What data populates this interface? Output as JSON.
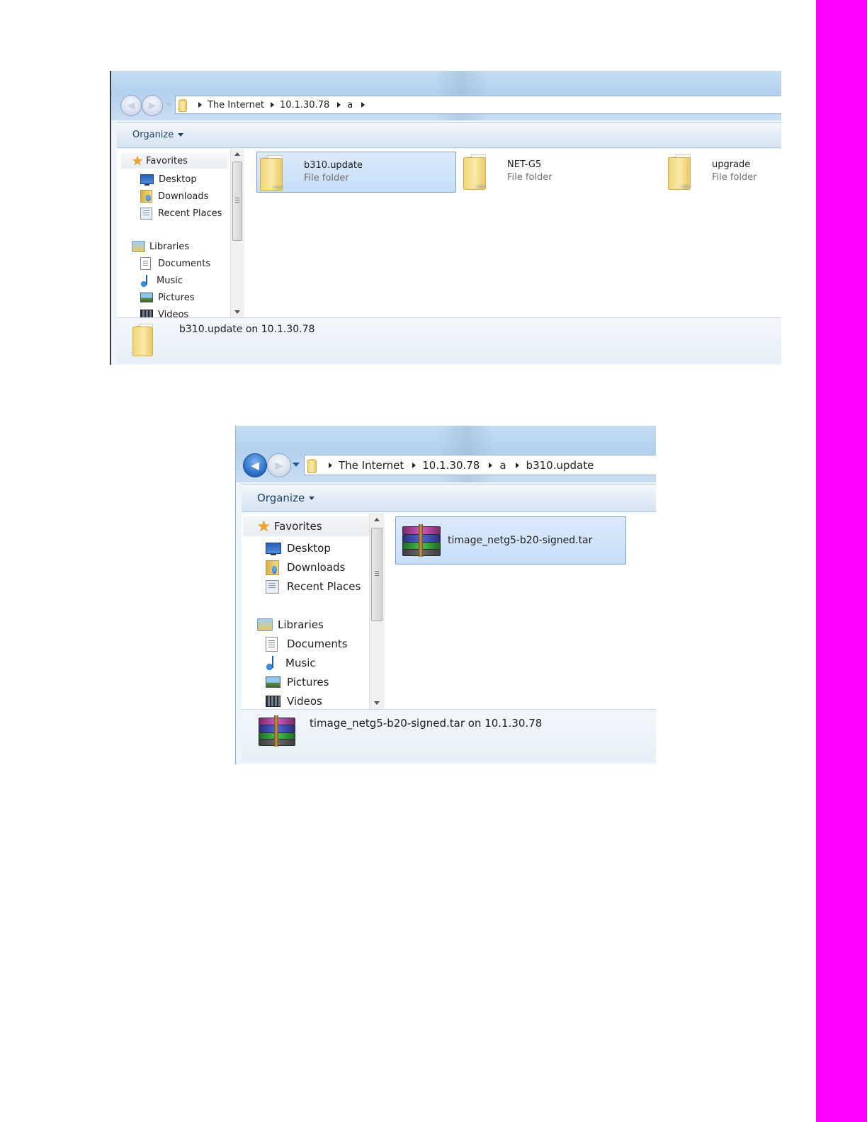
{
  "shots": [
    {
      "breadcrumb": [
        "The Internet",
        "10.1.30.78",
        "a"
      ],
      "organize_label": "Organize",
      "nav": {
        "favorites": "Favorites",
        "desktop": "Desktop",
        "downloads": "Downloads",
        "recent_places": "Recent Places",
        "libraries": "Libraries",
        "documents": "Documents",
        "music": "Music",
        "pictures": "Pictures",
        "videos": "Videos"
      },
      "items": [
        {
          "name": "b310.update",
          "type": "File folder",
          "selected": true
        },
        {
          "name": "NET-G5",
          "type": "File folder",
          "selected": false
        },
        {
          "name": "upgrade",
          "type": "File folder",
          "selected": false
        }
      ],
      "status_text": "b310.update on 10.1.30.78"
    },
    {
      "breadcrumb": [
        "The Internet",
        "10.1.30.78",
        "a",
        "b310.update"
      ],
      "organize_label": "Organize",
      "nav": {
        "favorites": "Favorites",
        "desktop": "Desktop",
        "downloads": "Downloads",
        "recent_places": "Recent Places",
        "libraries": "Libraries",
        "documents": "Documents",
        "music": "Music",
        "pictures": "Pictures",
        "videos": "Videos"
      },
      "items": [
        {
          "name": "timage_netg5-b20-signed.tar",
          "selected": true
        }
      ],
      "status_text": "timage_netg5-b20-signed.tar on 10.1.30.78"
    }
  ],
  "colors": {
    "sidebar_magenta": "#ff00ff",
    "selection": "#c7def8",
    "selection_border": "#7da2ce"
  },
  "icons": [
    "back-arrow-icon",
    "forward-arrow-icon",
    "folder-icon",
    "star-icon",
    "desktop-icon",
    "downloads-icon",
    "recent-places-icon",
    "libraries-icon",
    "documents-icon",
    "music-icon",
    "pictures-icon",
    "videos-icon",
    "winrar-archive-icon"
  ]
}
